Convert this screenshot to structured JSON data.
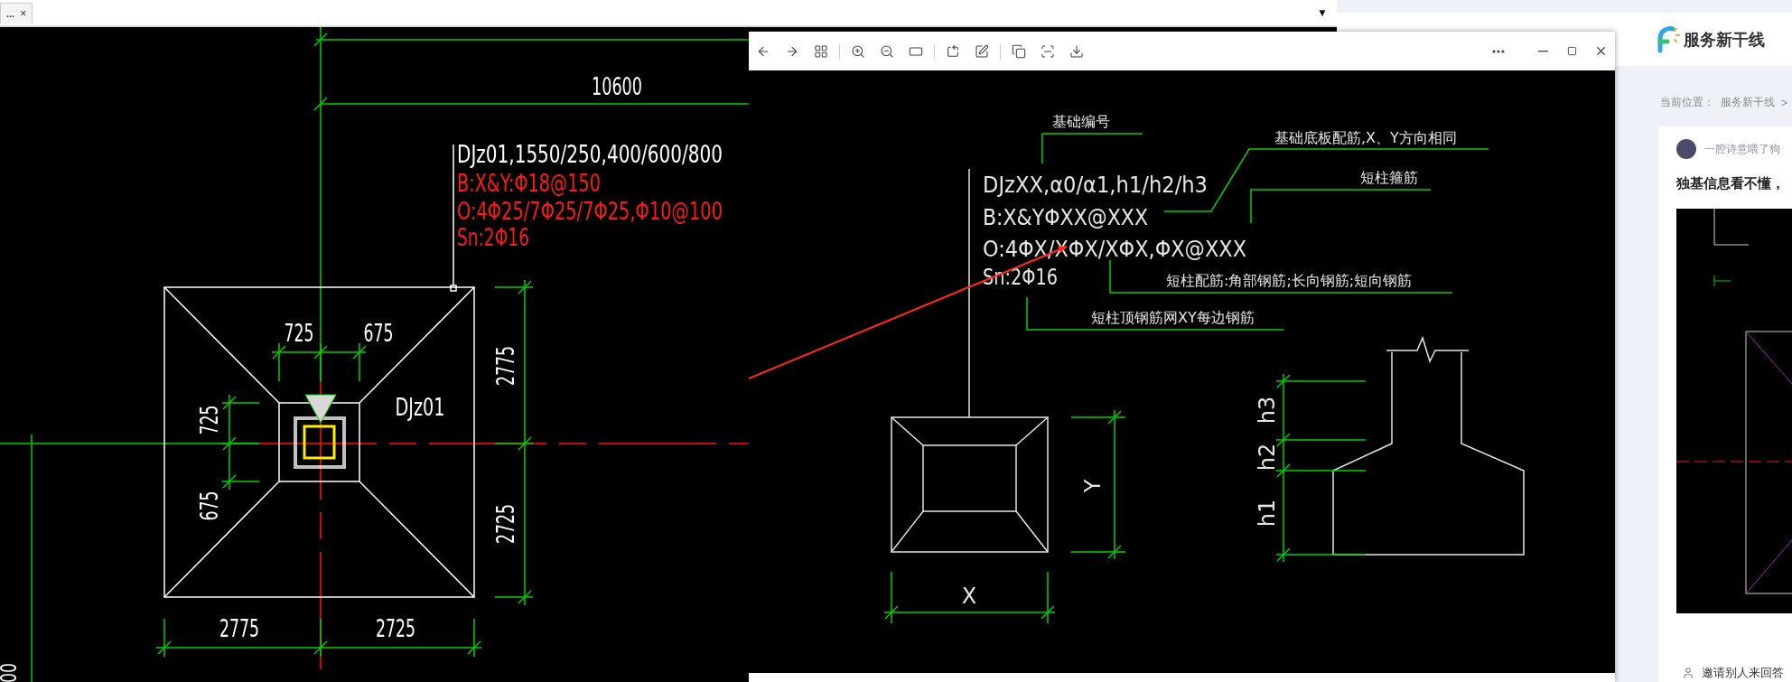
{
  "browser_tab": {
    "label": "...",
    "close": "×",
    "menu": "▼"
  },
  "cad_drawing": {
    "overall_dimension": "10600",
    "label_lines": [
      {
        "text": "DJz01,1550/250,400/600/800",
        "kind": "name"
      },
      {
        "text": "B:X&Y:Φ18@150",
        "kind": "rebar"
      },
      {
        "text": "O:4Φ25/7Φ25/7Φ25,Φ10@100",
        "kind": "rebar"
      },
      {
        "text": "Sn:2Φ16",
        "kind": "rebar"
      }
    ],
    "footing_tag": "DJz01",
    "top_dimensions": [
      "725",
      "675"
    ],
    "left_dimensions": [
      "725",
      "675"
    ],
    "right_dimensions": [
      "2775",
      "2725"
    ],
    "bottom_dimensions": [
      "2775",
      "2725"
    ],
    "edge_dimension": "00"
  },
  "image_viewer": {
    "diagram": {
      "title": "基础编号",
      "notation_lines": [
        "DJzXX,α0/α1,h1/h2/h3",
        "B:X&YΦXX@XXX",
        "O:4ΦX/XΦX/XΦX,ΦX@XXX",
        "Sn:2Φ16"
      ],
      "callouts": [
        "基础底板配筋,X、Y方向相同",
        "短柱箍筋",
        "短柱配筋:角部钢筋;长向钢筋;短向钢筋",
        "短柱顶钢筋网XY每边钢筋"
      ],
      "plan_labels": [
        "X",
        "Y"
      ],
      "section_labels": [
        "h3",
        "h2",
        "h1"
      ]
    }
  },
  "site": {
    "logo": "服务新干线",
    "breadcrumb": {
      "label": "当前位置：",
      "items": [
        "服务新干线",
        ">"
      ]
    },
    "post": {
      "author": "一腔诗意喂了狗",
      "title": "独基信息看不懂，"
    },
    "invite": "邀请别人来回答"
  }
}
